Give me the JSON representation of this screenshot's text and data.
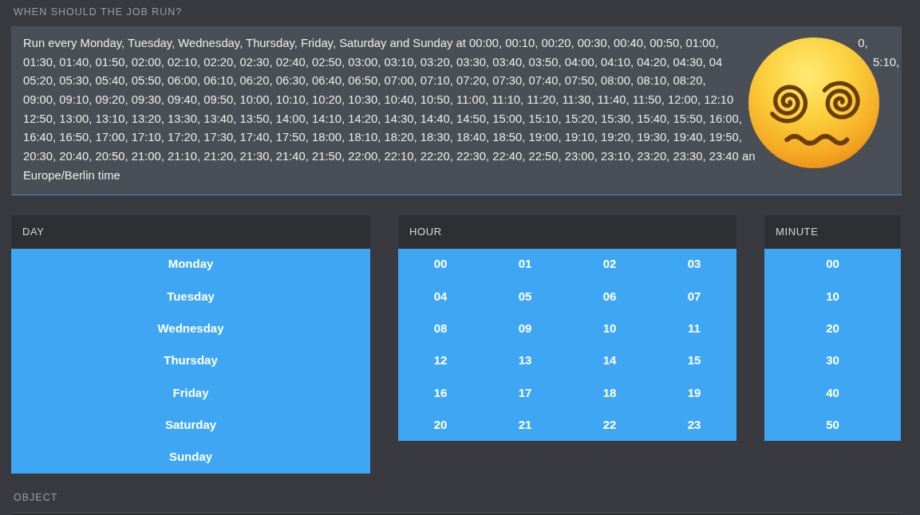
{
  "schedule": {
    "label": "WHEN SHOULD THE JOB RUN?",
    "summary_lines": [
      {
        "text": "Run every Monday, Tuesday, Wednesday, Thursday, Friday, Saturday and Sunday at 00:00, 00:10, 00:20, 00:30, 00:40, 00:50, 01:00,",
        "text_after_sticker": "0,"
      },
      {
        "text": "01:30, 01:40, 01:50, 02:00, 02:10, 02:20, 02:30, 02:40, 02:50, 03:00, 03:10, 03:20, 03:30, 03:40, 03:50, 04:00, 04:10, 04:20, 04:30, 04",
        "text_after_sticker": "5:10,"
      },
      {
        "text": "05:20, 05:30, 05:40, 05:50, 06:00, 06:10, 06:20, 06:30, 06:40, 06:50, 07:00, 07:10, 07:20, 07:30, 07:40, 07:50, 08:00, 08:10, 08:20,"
      },
      {
        "text": "09:00, 09:10, 09:20, 09:30, 09:40, 09:50, 10:00, 10:10, 10:20, 10:30, 10:40, 10:50, 11:00, 11:10, 11:20, 11:30, 11:40, 11:50, 12:00, 12:10"
      },
      {
        "text": "12:50, 13:00, 13:10, 13:20, 13:30, 13:40, 13:50, 14:00, 14:10, 14:20, 14:30, 14:40, 14:50, 15:00, 15:10, 15:20, 15:30, 15:40, 15:50, 16:00,"
      },
      {
        "text": "16:40, 16:50, 17:00, 17:10, 17:20, 17:30, 17:40, 17:50, 18:00, 18:10, 18:20, 18:30, 18:40, 18:50, 19:00, 19:10, 19:20, 19:30, 19:40, 19:50,"
      },
      {
        "text": "20:30, 20:40, 20:50, 21:00, 21:10, 21:20, 21:30, 21:40, 21:50, 22:00, 22:10, 22:20, 22:30, 22:40, 22:50, 23:00, 23:10, 23:20, 23:30, 23:40 an"
      },
      {
        "text": "Europe/Berlin time"
      }
    ]
  },
  "pickers": [
    {
      "kind": "day",
      "title": "DAY",
      "options": [
        {
          "label": "Monday",
          "selected": true
        },
        {
          "label": "Tuesday",
          "selected": true
        },
        {
          "label": "Wednesday",
          "selected": true
        },
        {
          "label": "Thursday",
          "selected": true
        },
        {
          "label": "Friday",
          "selected": true
        },
        {
          "label": "Saturday",
          "selected": true
        },
        {
          "label": "Sunday",
          "selected": true
        }
      ]
    },
    {
      "kind": "hour",
      "title": "HOUR",
      "options": [
        {
          "label": "00",
          "selected": true
        },
        {
          "label": "01",
          "selected": true
        },
        {
          "label": "02",
          "selected": true
        },
        {
          "label": "03",
          "selected": true
        },
        {
          "label": "04",
          "selected": true
        },
        {
          "label": "05",
          "selected": true
        },
        {
          "label": "06",
          "selected": true
        },
        {
          "label": "07",
          "selected": true
        },
        {
          "label": "08",
          "selected": true
        },
        {
          "label": "09",
          "selected": true
        },
        {
          "label": "10",
          "selected": true
        },
        {
          "label": "11",
          "selected": true
        },
        {
          "label": "12",
          "selected": true
        },
        {
          "label": "13",
          "selected": true
        },
        {
          "label": "14",
          "selected": true
        },
        {
          "label": "15",
          "selected": true
        },
        {
          "label": "16",
          "selected": true
        },
        {
          "label": "17",
          "selected": true
        },
        {
          "label": "18",
          "selected": true
        },
        {
          "label": "19",
          "selected": true
        },
        {
          "label": "20",
          "selected": true
        },
        {
          "label": "21",
          "selected": true
        },
        {
          "label": "22",
          "selected": true
        },
        {
          "label": "23",
          "selected": true
        }
      ]
    },
    {
      "kind": "minute",
      "title": "MINUTE",
      "options": [
        {
          "label": "00",
          "selected": true
        },
        {
          "label": "10",
          "selected": true
        },
        {
          "label": "20",
          "selected": true
        },
        {
          "label": "30",
          "selected": true
        },
        {
          "label": "40",
          "selected": true
        },
        {
          "label": "50",
          "selected": true
        }
      ]
    }
  ],
  "object": {
    "label": "OBJECT"
  }
}
